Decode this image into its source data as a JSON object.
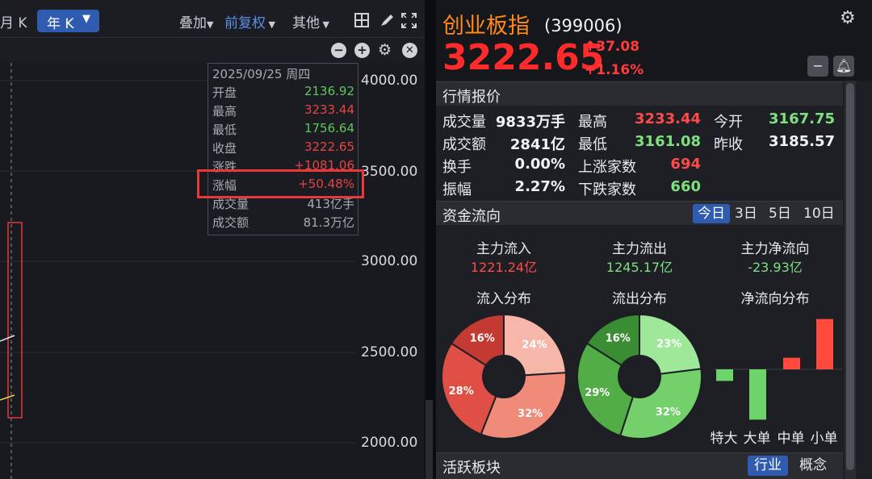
{
  "toolbar": {
    "month_k": "月 K",
    "year_k": "年 K",
    "overlay": "叠加",
    "adjust": "前复权",
    "other": "其他"
  },
  "y_axis": [
    "4000.00",
    "3500.00",
    "3000.00",
    "2500.00",
    "2000.00"
  ],
  "tooltip": {
    "date": "2025/09/25 周四",
    "rows": [
      {
        "label": "开盘",
        "value": "2136.92",
        "color": "#5ec55e"
      },
      {
        "label": "最高",
        "value": "3233.44",
        "color": "#e84343"
      },
      {
        "label": "最低",
        "value": "1756.64",
        "color": "#5ec55e"
      },
      {
        "label": "收盘",
        "value": "3222.65",
        "color": "#e84343"
      },
      {
        "label": "涨跌",
        "value": "+1081.06",
        "color": "#e84343"
      },
      {
        "label": "涨幅",
        "value": "+50.48%",
        "color": "#e84343"
      },
      {
        "label": "成交量",
        "value": "413亿手",
        "color": "#a7aab1"
      },
      {
        "label": "成交额",
        "value": "81.3万亿",
        "color": "#a7aab1"
      }
    ]
  },
  "quote": {
    "name": "创业板指",
    "code": "(399006)",
    "price": "3222.65",
    "change": "37.08",
    "change_pct": "+1.16%",
    "up_arrow": "🠕"
  },
  "market": {
    "title": "行情报价",
    "rows": [
      [
        {
          "l": "成交量",
          "v": "9833万手",
          "c": "wht"
        },
        {
          "l": "最高",
          "v": "3233.44",
          "c": "red"
        },
        {
          "l": "今开",
          "v": "3167.75",
          "c": "grn"
        }
      ],
      [
        {
          "l": "成交额",
          "v": "2841亿",
          "c": "wht"
        },
        {
          "l": "最低",
          "v": "3161.08",
          "c": "grn"
        },
        {
          "l": "昨收",
          "v": "3185.57",
          "c": "wht"
        }
      ],
      [
        {
          "l": "换手",
          "v": "0.00%",
          "c": "wht"
        },
        {
          "l": "上涨家数",
          "v": "694",
          "c": "red"
        },
        null
      ],
      [
        {
          "l": "振幅",
          "v": "2.27%",
          "c": "wht"
        },
        {
          "l": "下跌家数",
          "v": "660",
          "c": "grn"
        },
        null
      ]
    ]
  },
  "capital": {
    "title": "资金流向",
    "tabs": [
      "今日",
      "3日",
      "5日",
      "10日"
    ],
    "inflow_label": "主力流入",
    "inflow": "1221.24亿",
    "outflow_label": "主力流出",
    "outflow": "1245.17亿",
    "net_label": "主力净流向",
    "net": "-23.93亿",
    "inflow_dist_title": "流入分布",
    "outflow_dist_title": "流出分布",
    "net_dist_title": "净流向分布",
    "inflow_pct": [
      {
        "label": "24%",
        "value": 24,
        "color": "#f6b6a8"
      },
      {
        "label": "32%",
        "value": 32,
        "color": "#ef8b78"
      },
      {
        "label": "28%",
        "value": 28,
        "color": "#e04f45"
      },
      {
        "label": "16%",
        "value": 16,
        "color": "#c33a33"
      }
    ],
    "outflow_pct": [
      {
        "label": "23%",
        "value": 23,
        "color": "#9fe89a"
      },
      {
        "label": "32%",
        "value": 32,
        "color": "#73d06a"
      },
      {
        "label": "29%",
        "value": 29,
        "color": "#52ad47"
      },
      {
        "label": "16%",
        "value": 16,
        "color": "#3a8d33"
      }
    ],
    "net_bars": [
      {
        "label": "特大",
        "value": -0.3,
        "color": "#6cd46a"
      },
      {
        "label": "大单",
        "value": -1.3,
        "color": "#6cd46a"
      },
      {
        "label": "中单",
        "value": 0.3,
        "color": "#ff4a3d"
      },
      {
        "label": "小单",
        "value": 1.3,
        "color": "#ff4a3d"
      }
    ]
  },
  "sector": {
    "title": "活跃板块",
    "tabs": [
      "行业",
      "概念"
    ]
  }
}
